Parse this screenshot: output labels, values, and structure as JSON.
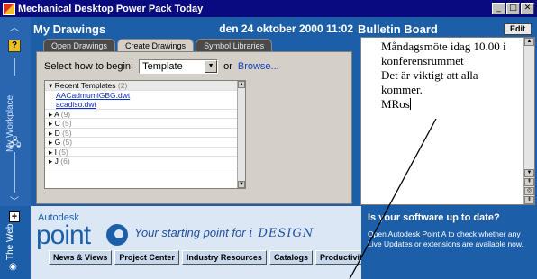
{
  "window": {
    "title": "Mechanical Desktop Power Pack Today",
    "buttons": [
      "_",
      "□",
      "✕"
    ]
  },
  "sidebar": {
    "help_label": "?",
    "vertical_label": "My Workplace"
  },
  "my_drawings": {
    "title": "My Drawings",
    "datetime": "den 24 oktober 2000 11:02",
    "tabs": [
      {
        "label": "Open Drawings",
        "active": false
      },
      {
        "label": "Create Drawings",
        "active": true
      },
      {
        "label": "Symbol Libraries",
        "active": false
      }
    ],
    "begin_label": "Select how to begin:",
    "begin_value": "Template",
    "or_label": "or",
    "browse_label": "Browse...",
    "list": {
      "recent_header": "Recent Templates",
      "recent_count": "(2)",
      "files": [
        "AACadmumiGBG.dwt",
        "acadiso.dwt"
      ],
      "groups": [
        {
          "letter": "A",
          "count": "(9)"
        },
        {
          "letter": "C",
          "count": "(5)"
        },
        {
          "letter": "D",
          "count": "(5)"
        },
        {
          "letter": "G",
          "count": "(5)"
        },
        {
          "letter": "I",
          "count": "(5)"
        },
        {
          "letter": "J",
          "count": "(6)"
        }
      ]
    }
  },
  "bulletin": {
    "title": "Bulletin Board",
    "edit_label": "Edit",
    "lines": [
      "Måndagsmöte idag 10.00 i",
      "konferensrummet",
      "Det är viktigt att alla",
      "kommer.",
      "MRos"
    ]
  },
  "web": {
    "plus_label": "+",
    "vertical_label": "The Web",
    "logo_top": "Autodesk",
    "logo_main": "point",
    "tagline_prefix": "Your starting point for",
    "tagline_brand": "i DESIGN",
    "buttons": [
      "News & Views",
      "Project Center",
      "Industry Resources",
      "Catalogs",
      "Productivity Cente"
    ],
    "update_title": "Is your software up to date?",
    "update_text": "Open Autodesk Point A to check whether any Live Updates or extensions are available now."
  },
  "colors": {
    "titlebar": "#0a0a80",
    "workspace": "#1c5fa8",
    "panel": "#d4d0c8"
  }
}
